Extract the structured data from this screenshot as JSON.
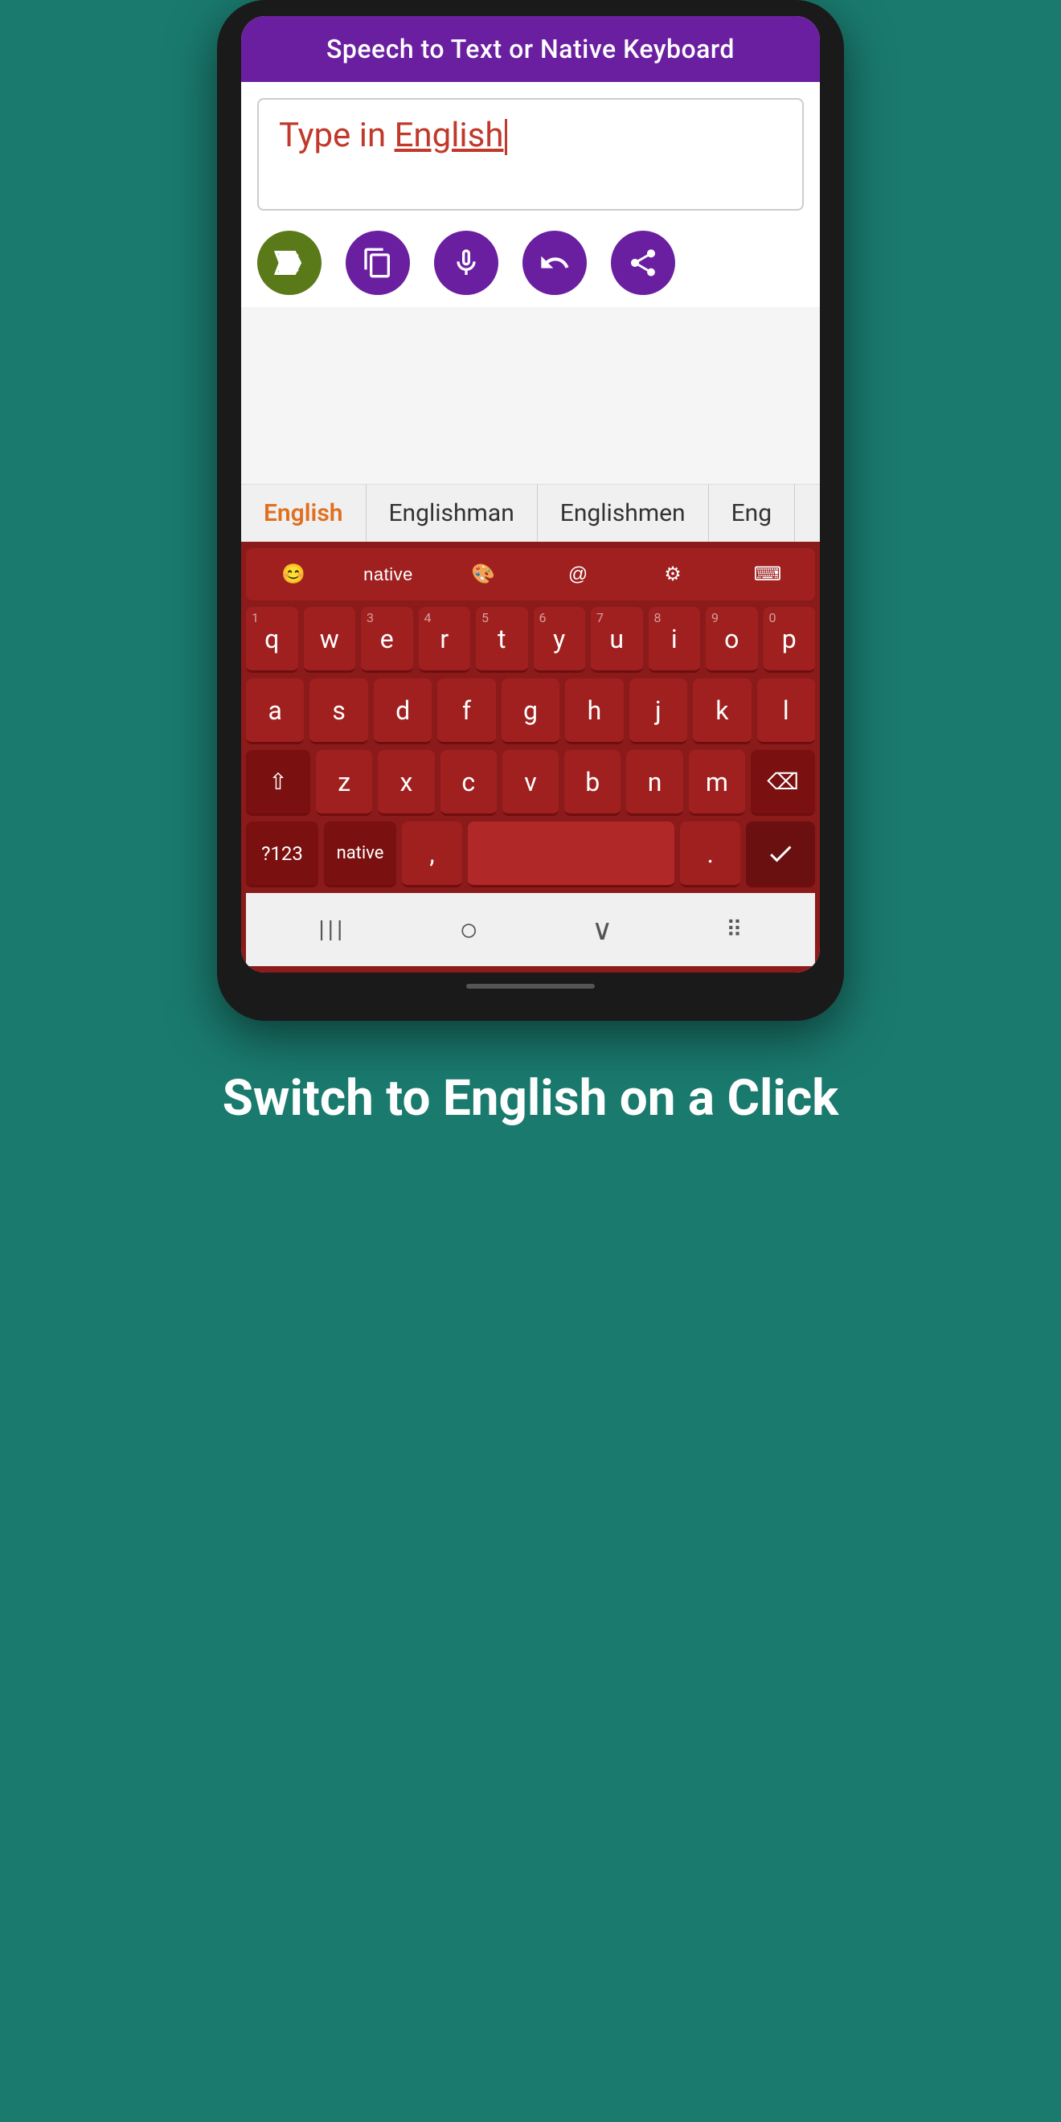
{
  "header": {
    "title": "Speech to Text or Native Keyboard"
  },
  "textInput": {
    "prefix": "Type in ",
    "language": "English",
    "placeholder": "Type in English"
  },
  "actionButtons": [
    {
      "name": "delete-button",
      "icon": "delete",
      "color": "#5a7a1a"
    },
    {
      "name": "copy-button",
      "icon": "copy",
      "color": "#6a1fa0"
    },
    {
      "name": "mic-button",
      "icon": "mic",
      "color": "#6a1fa0"
    },
    {
      "name": "undo-button",
      "icon": "undo",
      "color": "#6a1fa0"
    },
    {
      "name": "share-button",
      "icon": "share",
      "color": "#6a1fa0"
    }
  ],
  "suggestions": [
    {
      "label": "English",
      "active": true
    },
    {
      "label": "Englishman",
      "active": false
    },
    {
      "label": "Englishmen",
      "active": false
    },
    {
      "label": "Eng",
      "active": false
    }
  ],
  "keyboard": {
    "toolbarItems": [
      {
        "label": "😊",
        "name": "emoji"
      },
      {
        "label": "native",
        "name": "native-toggle"
      },
      {
        "label": "🎨",
        "name": "theme"
      },
      {
        "label": "@",
        "name": "at-symbol"
      },
      {
        "label": "⚙",
        "name": "settings"
      },
      {
        "label": "⌨",
        "name": "keyboard-switch"
      }
    ],
    "rows": [
      [
        {
          "key": "q",
          "num": "1"
        },
        {
          "key": "w",
          "num": ""
        },
        {
          "key": "e",
          "num": "3"
        },
        {
          "key": "r",
          "num": "4"
        },
        {
          "key": "t",
          "num": "5"
        },
        {
          "key": "y",
          "num": "6"
        },
        {
          "key": "u",
          "num": "7"
        },
        {
          "key": "i",
          "num": "8"
        },
        {
          "key": "o",
          "num": "9"
        },
        {
          "key": "p",
          "num": "0"
        }
      ],
      [
        {
          "key": "a",
          "num": ""
        },
        {
          "key": "s",
          "num": ""
        },
        {
          "key": "d",
          "num": ""
        },
        {
          "key": "f",
          "num": ""
        },
        {
          "key": "g",
          "num": ""
        },
        {
          "key": "h",
          "num": ""
        },
        {
          "key": "j",
          "num": ""
        },
        {
          "key": "k",
          "num": ""
        },
        {
          "key": "l",
          "num": ""
        }
      ],
      [
        {
          "key": "⇧",
          "num": "",
          "action": true
        },
        {
          "key": "z",
          "num": ""
        },
        {
          "key": "x",
          "num": ""
        },
        {
          "key": "c",
          "num": ""
        },
        {
          "key": "v",
          "num": ""
        },
        {
          "key": "b",
          "num": ""
        },
        {
          "key": "n",
          "num": ""
        },
        {
          "key": "m",
          "num": ""
        },
        {
          "key": "⌫",
          "num": "",
          "action": true
        }
      ],
      [
        {
          "key": "?123",
          "num": "",
          "special": true
        },
        {
          "key": "native",
          "num": "",
          "special": true
        },
        {
          "key": ",",
          "num": ""
        },
        {
          "key": " ",
          "num": "",
          "space": true
        },
        {
          "key": ".",
          "num": ""
        },
        {
          "key": "✓",
          "num": "",
          "done": true
        }
      ]
    ],
    "navBar": {
      "back": "|||",
      "home": "○",
      "recent": "∨",
      "grid": "⠿"
    }
  },
  "bottomText": "Switch to English on a Click"
}
